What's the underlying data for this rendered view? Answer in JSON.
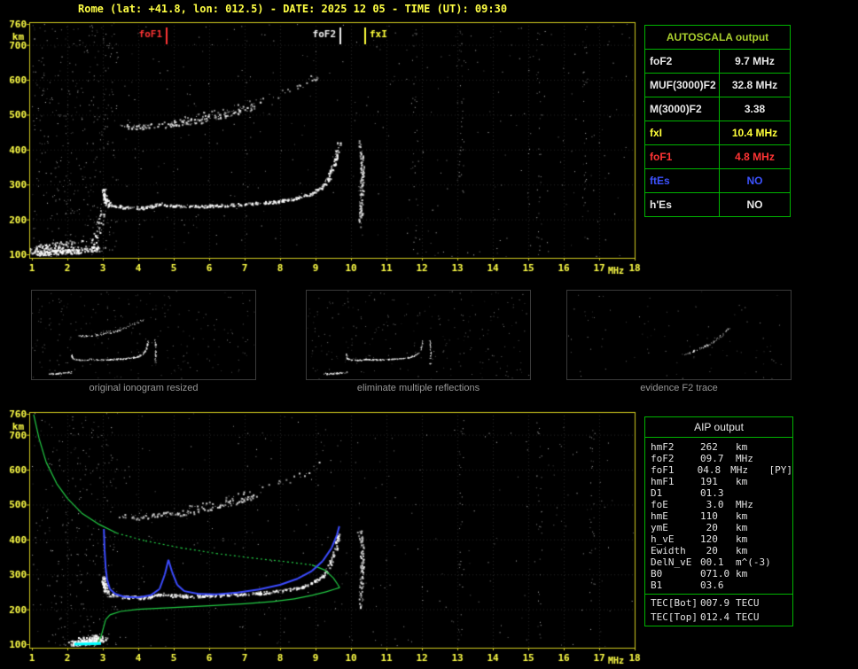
{
  "header": {
    "title": "Rome (lat: +41.8, lon: 012.5) - DATE: 2025 12 05 - TIME (UT): 09:30"
  },
  "colors": {
    "background": "#000000",
    "axis_yellow": "#ffff46",
    "plot_border": "#cfc81e",
    "table_border": "#00b400",
    "autoscala_title_green": "#a9ce2e",
    "value_red": "#ff3434",
    "value_yellow": "#ffff3a",
    "value_blue": "#3d52ff",
    "profile_green": "#22cc44",
    "restored_trace_blue": "#3b4bff",
    "cyan": "#00ffff",
    "caption_gray": "#979797"
  },
  "autoscala": {
    "title": "AUTOSCALA output",
    "rows": [
      {
        "label": "foF2",
        "value": "9.7 MHz"
      },
      {
        "label": "MUF(3000)F2",
        "value": "32.8 MHz"
      },
      {
        "label": "M(3000)F2",
        "value": "3.38"
      },
      {
        "label": "fxI",
        "value": "10.4 MHz"
      },
      {
        "label": "foF1",
        "value": "4.8 MHz"
      },
      {
        "label": "ftEs",
        "value": "NO"
      },
      {
        "label": "h'Es",
        "value": "NO"
      }
    ]
  },
  "aip": {
    "title": "AIP output",
    "rows": [
      {
        "name": "hmF2",
        "value": "262",
        "unit": "km"
      },
      {
        "name": "foF2",
        "value": "09.7",
        "unit": "MHz"
      },
      {
        "name": "foF1",
        "value": "04.8",
        "unit": "MHz",
        "extra": "[PY]"
      },
      {
        "name": "hmF1",
        "value": "191",
        "unit": "km"
      },
      {
        "name": "D1",
        "value": "01.3",
        "unit": ""
      },
      {
        "name": "foE",
        "value": " 3.0",
        "unit": "MHz"
      },
      {
        "name": "hmE",
        "value": "110",
        "unit": "km"
      },
      {
        "name": "ymE",
        "value": " 20",
        "unit": "km"
      },
      {
        "name": "h_vE",
        "value": "120",
        "unit": "km"
      },
      {
        "name": "Ewidth",
        "value": " 20",
        "unit": "km"
      },
      {
        "name": "DelN_vE",
        "value": "00.1",
        "unit": "m^(-3)"
      },
      {
        "name": "B0",
        "value": "071.0",
        "unit": "km"
      },
      {
        "name": "B1",
        "value": "03.6",
        "unit": ""
      },
      {
        "name": "TEC[Bot]",
        "value": "007.9",
        "unit": "TECU"
      },
      {
        "name": "TEC[Top]",
        "value": "012.4",
        "unit": "TECU"
      }
    ]
  },
  "thumbnails": [
    {
      "caption": "original ionogram resized"
    },
    {
      "caption": "eliminate multiple reflections"
    },
    {
      "caption": "evidence F2 trace"
    }
  ],
  "chart_data": [
    {
      "type": "scatter",
      "name": "scaled-ionogram",
      "xlabel": "MHz",
      "ylabel": "km",
      "xlim": [
        1,
        18
      ],
      "ylim": [
        100,
        760
      ],
      "grid": true,
      "x_ticks": [
        1,
        2,
        3,
        4,
        5,
        6,
        7,
        8,
        9,
        10,
        11,
        12,
        13,
        14,
        15,
        16,
        17,
        18
      ],
      "y_ticks": [
        100,
        200,
        300,
        400,
        500,
        600,
        700,
        760
      ],
      "markers": [
        {
          "label": "foF1",
          "freq": 4.8,
          "color": "#ff3434",
          "label_side": "left"
        },
        {
          "label": "foF2",
          "freq": 9.7,
          "color": "#f0f0f0",
          "label_side": "left"
        },
        {
          "label": "fxI",
          "freq": 10.4,
          "color": "#ffff3a",
          "label_side": "right"
        }
      ],
      "noise": {
        "count": 700,
        "left_bias": 0.5,
        "columns": [
          11.8,
          13.1,
          15.3,
          16.6
        ]
      },
      "traces": [
        {
          "name": "E-region-echoes",
          "color": "#ffffff",
          "density": 200,
          "jitter": [
            0.18,
            7
          ],
          "points": [
            [
              1.05,
              102
            ],
            [
              1.6,
              104
            ],
            [
              2.1,
              107
            ],
            [
              2.6,
              112
            ],
            [
              2.95,
              116
            ]
          ]
        },
        {
          "name": "low-left-cluster",
          "color": "#ffffff",
          "density": 130,
          "jitter": [
            0.3,
            16
          ],
          "points": [
            [
              1.0,
              108
            ],
            [
              1.5,
              114
            ],
            [
              2.0,
              120
            ],
            [
              2.4,
              126
            ]
          ]
        },
        {
          "name": "pre-hook-scatter",
          "color": "#ffffff",
          "density": 40,
          "jitter": [
            0.08,
            16
          ],
          "points": [
            [
              2.75,
              130
            ],
            [
              2.9,
              170
            ],
            [
              3.0,
              215
            ]
          ]
        },
        {
          "name": "E-F-retardation",
          "color": "#ffffff",
          "density": 70,
          "jitter": [
            0.05,
            9
          ],
          "points": [
            [
              3.02,
              288
            ],
            [
              3.07,
              262
            ],
            [
              3.12,
              248
            ],
            [
              3.22,
              240
            ]
          ]
        },
        {
          "name": "F-trace",
          "color": "#ffffff",
          "density": 430,
          "jitter": [
            0.05,
            4
          ],
          "points": [
            [
              3.22,
              240
            ],
            [
              3.6,
              234
            ],
            [
              4.2,
              232
            ],
            [
              4.7,
              243
            ],
            [
              4.95,
              238
            ],
            [
              5.5,
              236
            ],
            [
              6.2,
              238
            ],
            [
              7.0,
              242
            ],
            [
              7.8,
              248
            ],
            [
              8.4,
              257
            ],
            [
              8.9,
              272
            ],
            [
              9.2,
              292
            ],
            [
              9.4,
              320
            ],
            [
              9.55,
              360
            ],
            [
              9.63,
              395
            ],
            [
              9.68,
              418
            ]
          ]
        },
        {
          "name": "multiple-hop",
          "color": "#e0e0e0",
          "density": 170,
          "jitter": [
            0.09,
            8
          ],
          "points": [
            [
              3.5,
              462
            ],
            [
              4.0,
              464
            ],
            [
              4.6,
              468
            ],
            [
              5.2,
              474
            ],
            [
              5.8,
              484
            ],
            [
              6.4,
              497
            ],
            [
              6.9,
              510
            ],
            [
              7.3,
              522
            ]
          ]
        },
        {
          "name": "multiple-rise",
          "color": "#d8d8d8",
          "density": 60,
          "jitter": [
            0.08,
            9
          ],
          "points": [
            [
              5.0,
              480
            ],
            [
              6.0,
              500
            ],
            [
              7.0,
              525
            ],
            [
              7.8,
              552
            ],
            [
              8.6,
              585
            ],
            [
              9.2,
              615
            ]
          ]
        },
        {
          "name": "x-mode-streak",
          "color": "#dddddd",
          "density": 130,
          "jitter": [
            0.05,
            11
          ],
          "points": [
            [
              10.28,
              185
            ],
            [
              10.3,
              240
            ],
            [
              10.32,
              300
            ],
            [
              10.33,
              350
            ],
            [
              10.3,
              400
            ],
            [
              10.24,
              422
            ]
          ]
        }
      ]
    },
    {
      "type": "scatter",
      "name": "aip-ionogram-with-profile",
      "xlabel": "MHz",
      "ylabel": "km",
      "xlim": [
        1,
        18
      ],
      "ylim": [
        100,
        760
      ],
      "grid": true,
      "x_ticks": [
        1,
        2,
        3,
        4,
        5,
        6,
        7,
        8,
        9,
        10,
        11,
        12,
        13,
        14,
        15,
        16,
        17,
        18
      ],
      "y_ticks": [
        100,
        200,
        300,
        400,
        500,
        600,
        700,
        760
      ],
      "markers": [],
      "noise": {
        "count": 520,
        "left_bias": 0.45,
        "columns": [
          13.1,
          15.3,
          16.8
        ]
      },
      "traces": [
        {
          "name": "E-region-echoes",
          "color": "#ffffff",
          "density": 150,
          "jitter": [
            0.16,
            7
          ],
          "points": [
            [
              2.1,
              102
            ],
            [
              2.5,
              104
            ],
            [
              2.8,
              108
            ],
            [
              3.0,
              114
            ]
          ]
        },
        {
          "name": "low-left-cluster",
          "color": "#ffffff",
          "density": 90,
          "jitter": [
            0.2,
            12
          ],
          "points": [
            [
              2.3,
              104
            ],
            [
              2.6,
              110
            ],
            [
              2.9,
              120
            ]
          ]
        },
        {
          "name": "E-F-retardation",
          "color": "#ffffff",
          "density": 70,
          "jitter": [
            0.05,
            9
          ],
          "points": [
            [
              3.02,
              288
            ],
            [
              3.07,
              262
            ],
            [
              3.12,
              248
            ],
            [
              3.22,
              240
            ]
          ]
        },
        {
          "name": "F-trace",
          "color": "#ffffff",
          "density": 430,
          "jitter": [
            0.05,
            4
          ],
          "points": [
            [
              3.22,
              240
            ],
            [
              3.6,
              234
            ],
            [
              4.2,
              232
            ],
            [
              4.7,
              243
            ],
            [
              4.95,
              238
            ],
            [
              5.5,
              236
            ],
            [
              6.2,
              238
            ],
            [
              7.0,
              242
            ],
            [
              7.8,
              248
            ],
            [
              8.4,
              257
            ],
            [
              8.9,
              272
            ],
            [
              9.2,
              292
            ],
            [
              9.4,
              320
            ],
            [
              9.55,
              360
            ],
            [
              9.63,
              395
            ],
            [
              9.68,
              418
            ]
          ]
        },
        {
          "name": "multiple-hop",
          "color": "#e0e0e0",
          "density": 130,
          "jitter": [
            0.09,
            8
          ],
          "points": [
            [
              3.5,
              462
            ],
            [
              4.0,
              464
            ],
            [
              4.6,
              468
            ],
            [
              5.2,
              474
            ],
            [
              5.8,
              484
            ],
            [
              6.4,
              497
            ],
            [
              6.9,
              510
            ],
            [
              7.3,
              522
            ]
          ]
        },
        {
          "name": "multiple-rise",
          "color": "#d8d8d8",
          "density": 45,
          "jitter": [
            0.08,
            9
          ],
          "points": [
            [
              5.0,
              480
            ],
            [
              6.0,
              500
            ],
            [
              7.0,
              525
            ],
            [
              7.8,
              552
            ],
            [
              8.6,
              585
            ],
            [
              9.2,
              615
            ]
          ]
        },
        {
          "name": "x-mode-streak",
          "color": "#dddddd",
          "density": 110,
          "jitter": [
            0.05,
            11
          ],
          "points": [
            [
              10.28,
              200
            ],
            [
              10.3,
              250
            ],
            [
              10.32,
              300
            ],
            [
              10.33,
              350
            ],
            [
              10.3,
              400
            ],
            [
              10.24,
              420
            ]
          ]
        }
      ],
      "series": [
        {
          "name": "topside-profile",
          "color": "#22cc44",
          "width": 1.2,
          "dash_range": [
            3.4,
            9.0
          ],
          "points": [
            [
              1.05,
              758
            ],
            [
              1.2,
              690
            ],
            [
              1.4,
              622
            ],
            [
              1.7,
              560
            ],
            [
              2.0,
              518
            ],
            [
              2.4,
              476
            ],
            [
              2.9,
              443
            ],
            [
              3.4,
              418
            ],
            [
              4.2,
              396
            ],
            [
              5.2,
              376
            ],
            [
              6.2,
              360
            ],
            [
              7.2,
              347
            ],
            [
              8.2,
              336
            ],
            [
              8.9,
              327
            ],
            [
              9.25,
              313
            ],
            [
              9.5,
              290
            ],
            [
              9.62,
              272
            ],
            [
              9.68,
              262
            ]
          ]
        },
        {
          "name": "bottomside-profile",
          "color": "#22cc44",
          "width": 1.2,
          "points": [
            [
              2.75,
              96
            ],
            [
              2.85,
              104
            ],
            [
              2.95,
              122
            ],
            [
              3.02,
              148
            ],
            [
              3.08,
              170
            ],
            [
              3.2,
              184
            ],
            [
              3.5,
              194
            ],
            [
              4.0,
              200
            ],
            [
              5.0,
              205
            ],
            [
              6.0,
              210
            ],
            [
              7.0,
              216
            ],
            [
              7.8,
              222
            ],
            [
              8.4,
              230
            ],
            [
              8.9,
              240
            ],
            [
              9.3,
              250
            ],
            [
              9.55,
              258
            ],
            [
              9.68,
              262
            ]
          ]
        },
        {
          "name": "restored-h-trace",
          "color": "#3b4bff",
          "width": 2,
          "points": [
            [
              3.03,
              430
            ],
            [
              3.05,
              370
            ],
            [
              3.08,
              320
            ],
            [
              3.12,
              285
            ],
            [
              3.2,
              258
            ],
            [
              3.35,
              244
            ],
            [
              3.6,
              236
            ],
            [
              4.0,
              234
            ],
            [
              4.35,
              240
            ],
            [
              4.6,
              258
            ],
            [
              4.75,
              300
            ],
            [
              4.85,
              342
            ],
            [
              4.95,
              308
            ],
            [
              5.1,
              270
            ],
            [
              5.3,
              252
            ],
            [
              5.7,
              244
            ],
            [
              6.2,
              243
            ],
            [
              6.8,
              248
            ],
            [
              7.4,
              257
            ],
            [
              8.0,
              270
            ],
            [
              8.5,
              288
            ],
            [
              8.9,
              310
            ],
            [
              9.2,
              338
            ],
            [
              9.45,
              375
            ],
            [
              9.6,
              412
            ],
            [
              9.67,
              438
            ]
          ]
        },
        {
          "name": "cyan-e-mark",
          "color": "#00ffff",
          "width": 3,
          "points": [
            [
              2.2,
              100
            ],
            [
              2.95,
              102
            ]
          ]
        }
      ]
    }
  ]
}
